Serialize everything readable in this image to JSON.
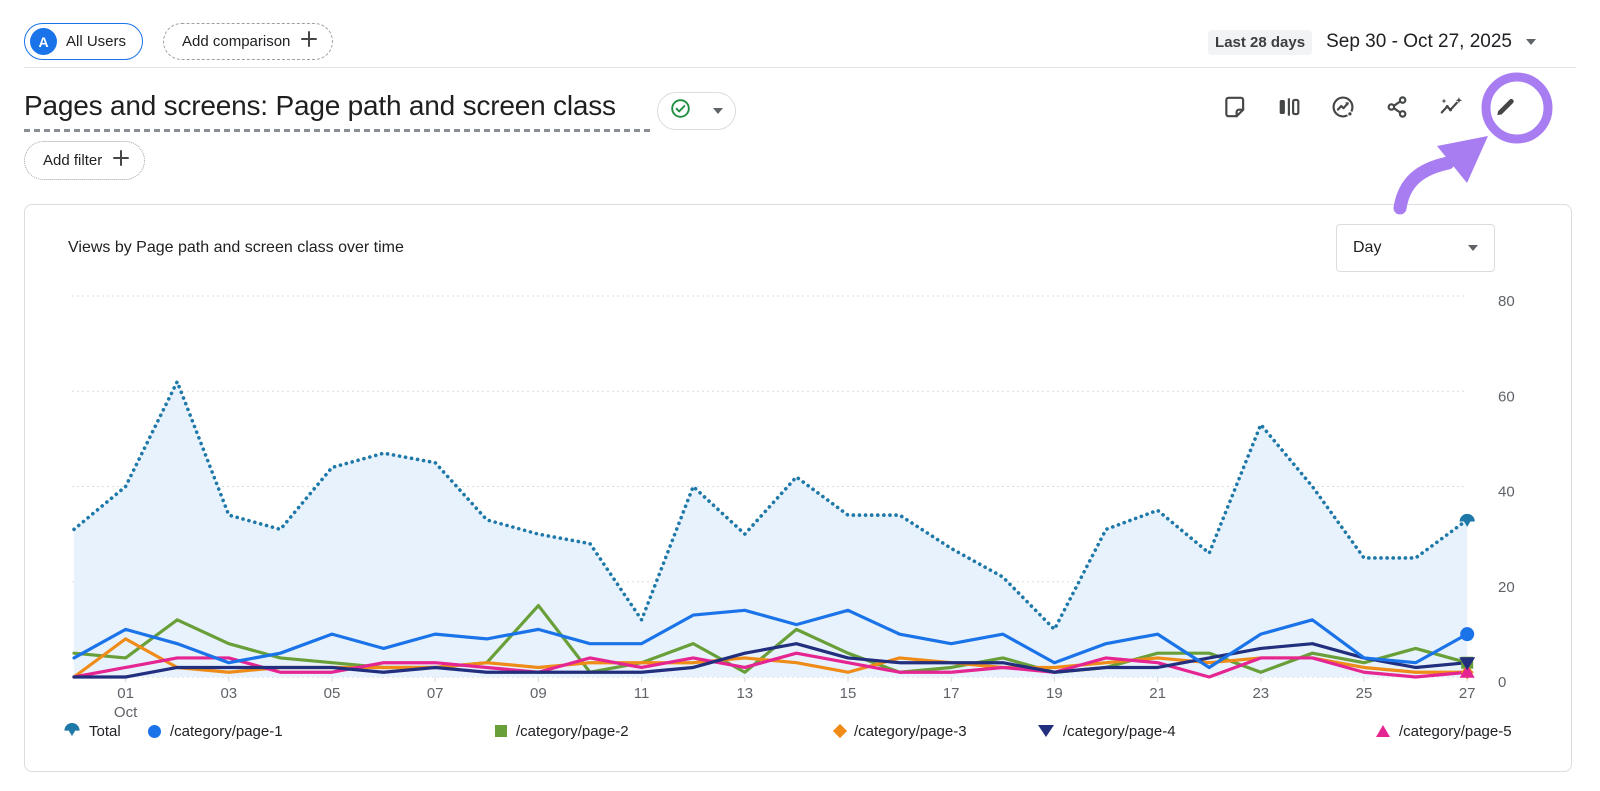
{
  "header": {
    "avatar_letter": "A",
    "audience_chip": "All Users",
    "add_comparison": "Add comparison",
    "date_preset": "Last 28 days",
    "date_range": "Sep 30 - Oct 27, 2025"
  },
  "report": {
    "title": "Pages and screens: Page path and screen class",
    "status_icon": "check-circle",
    "status_color": "#1e8e3e",
    "add_filter": "Add filter",
    "toolbar_icons": [
      "note-icon",
      "comparison-icon",
      "insights-icon",
      "share-icon",
      "sparkline-icon",
      "edit-icon"
    ]
  },
  "card": {
    "title": "Views by Page path and screen class over time",
    "granularity": "Day"
  },
  "annotation": {
    "color": "#a87df2",
    "shapes": [
      "circle-around-edit-icon",
      "curved-arrow"
    ]
  },
  "chart_data": {
    "type": "line",
    "title": "Views by Page path and screen class over time",
    "x_points": 28,
    "x_range": "Sep 30 - Oct 27, 2025",
    "x_month_label": "Oct",
    "x_tick_labels": [
      "01",
      "03",
      "05",
      "07",
      "09",
      "11",
      "13",
      "15",
      "17",
      "19",
      "21",
      "23",
      "25",
      "27"
    ],
    "x_tick_day_indices": [
      1,
      3,
      5,
      7,
      9,
      11,
      13,
      15,
      17,
      19,
      21,
      23,
      25,
      27
    ],
    "y_ticks": [
      0,
      20,
      40,
      60,
      80
    ],
    "ylim": [
      0,
      84
    ],
    "grid": "horizontal-dotted",
    "legend_position": "bottom",
    "series": [
      {
        "name": "Total",
        "color": "#1e78a8",
        "fill": "#e8f2fc",
        "line_style": "dotted",
        "marker": "fan",
        "values": [
          31,
          40,
          62,
          34,
          31,
          44,
          47,
          45,
          33,
          30,
          28,
          12,
          40,
          30,
          42,
          34,
          34,
          27,
          21,
          10,
          31,
          35,
          26,
          53,
          40,
          25,
          25,
          33
        ]
      },
      {
        "name": "/category/page-1",
        "color": "#1a73e8",
        "line_style": "solid",
        "marker": "circle",
        "values": [
          4,
          10,
          7,
          3,
          5,
          9,
          6,
          9,
          8,
          10,
          7,
          7,
          13,
          14,
          11,
          14,
          9,
          7,
          9,
          3,
          7,
          9,
          2,
          9,
          12,
          4,
          3,
          9
        ]
      },
      {
        "name": "/category/page-2",
        "color": "#689f38",
        "line_style": "solid",
        "marker": "square",
        "values": [
          5,
          4,
          12,
          7,
          4,
          3,
          2,
          2,
          3,
          15,
          1,
          3,
          7,
          1,
          10,
          5,
          1,
          2,
          4,
          1,
          2,
          5,
          5,
          1,
          5,
          3,
          6,
          3
        ]
      },
      {
        "name": "/category/page-3",
        "color": "#ef8b17",
        "line_style": "solid",
        "marker": "diamond",
        "values": [
          0,
          8,
          2,
          1,
          2,
          2,
          2,
          2,
          3,
          2,
          3,
          3,
          3,
          4,
          3,
          1,
          4,
          3,
          2,
          2,
          3,
          4,
          3,
          4,
          4,
          2,
          1,
          1
        ]
      },
      {
        "name": "/category/page-4",
        "color": "#222e7e",
        "line_style": "solid",
        "marker": "triangle-down",
        "values": [
          0,
          0,
          2,
          2,
          2,
          2,
          1,
          2,
          1,
          1,
          1,
          1,
          2,
          5,
          7,
          4,
          3,
          3,
          3,
          1,
          2,
          2,
          4,
          6,
          7,
          4,
          2,
          3
        ]
      },
      {
        "name": "/category/page-5",
        "color": "#e52592",
        "line_style": "solid",
        "marker": "triangle-up",
        "values": [
          0,
          2,
          4,
          4,
          1,
          1,
          3,
          3,
          2,
          1,
          4,
          2,
          4,
          2,
          5,
          3,
          1,
          1,
          2,
          1,
          4,
          3,
          0,
          4,
          4,
          1,
          0,
          1
        ]
      }
    ]
  }
}
